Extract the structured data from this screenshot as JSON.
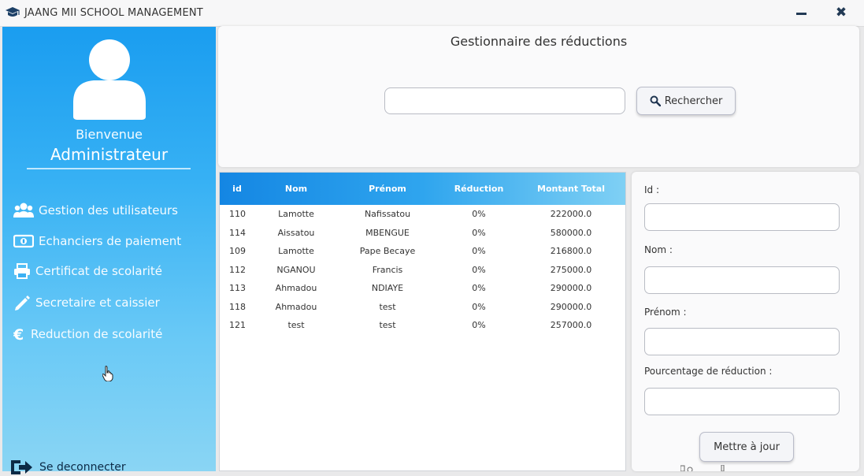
{
  "window": {
    "title": "JAANG MII SCHOOL MANAGEMENT",
    "minimize_icon": "minimize-icon",
    "close_icon": "close-icon",
    "close_glyph": "✖"
  },
  "sidebar": {
    "avatar_icon": "user-avatar-icon",
    "welcome": "Bienvenue",
    "role": "Administrateur",
    "items": [
      {
        "icon": "users-icon",
        "label": "Gestion des utilisateurs"
      },
      {
        "icon": "money-icon",
        "label": "Echanciers de paiement"
      },
      {
        "icon": "printer-icon",
        "label": "Certificat de scolarité"
      },
      {
        "icon": "pencil-icon",
        "label": "Secretaire et caissier"
      },
      {
        "icon": "euro-icon",
        "label": "Reduction de scolarité"
      }
    ],
    "logout": {
      "icon": "logout-icon",
      "label": "Se deconnecter"
    }
  },
  "header": {
    "title": "Gestionnaire des réductions",
    "search_value": "",
    "search_button_label": "Rechercher",
    "search_icon": "search-icon"
  },
  "table": {
    "columns": [
      "id",
      "Nom",
      "Prénom",
      "Réduction",
      "Montant Total"
    ],
    "rows": [
      [
        "110",
        "Lamotte",
        "Nafissatou",
        "0%",
        "222000.0"
      ],
      [
        "114",
        "Aissatou",
        "MBENGUE",
        "0%",
        "580000.0"
      ],
      [
        "109",
        "Lamotte",
        "Pape Becaye",
        "0%",
        "216800.0"
      ],
      [
        "112",
        "NGANOU",
        "Francis",
        "0%",
        "275000.0"
      ],
      [
        "113",
        "Ahmadou",
        "NDIAYE",
        "0%",
        "290000.0"
      ],
      [
        "118",
        "Ahmadou",
        "test",
        "0%",
        "290000.0"
      ],
      [
        "121",
        "test",
        "test",
        "0%",
        "257000.0"
      ]
    ]
  },
  "form": {
    "id_label": "Id :",
    "id_value": "",
    "nom_label": "Nom :",
    "nom_value": "",
    "prenom_label": "Prénom :",
    "prenom_value": "",
    "reduction_label": "Pourcentage de réduction :",
    "reduction_value": "",
    "update_button_label": "Mettre à jour"
  },
  "colors": {
    "sidebar_top": "#1a9df0",
    "sidebar_bottom": "#8ad5f4",
    "table_header_start": "#1486e3",
    "table_header_end": "#7fd0f4"
  }
}
